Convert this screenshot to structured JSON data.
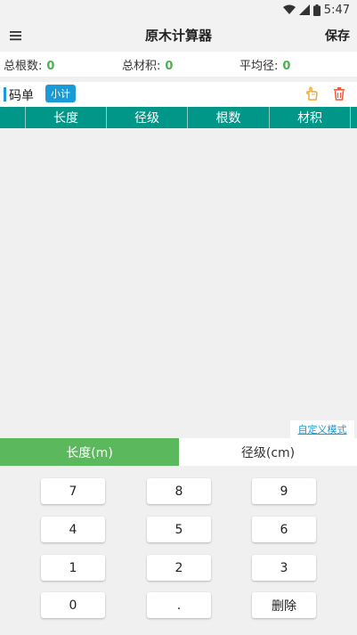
{
  "status_bar": {
    "time": "5:47"
  },
  "app_bar": {
    "title": "原木计算器",
    "save_label": "保存"
  },
  "summary": {
    "total_count_label": "总根数:",
    "total_count_value": "0",
    "total_volume_label": "总材积:",
    "total_volume_value": "0",
    "avg_diameter_label": "平均径:",
    "avg_diameter_value": "0"
  },
  "code_list": {
    "title": "码单",
    "subtotal_label": "小计",
    "columns": [
      "长度",
      "径级",
      "根数",
      "材积"
    ]
  },
  "custom_mode_label": "自定义模式",
  "input_tabs": {
    "length_label": "长度(m)",
    "diameter_label": "径级(cm)",
    "active": "length"
  },
  "keypad": {
    "keys": [
      "7",
      "8",
      "9",
      "4",
      "5",
      "6",
      "1",
      "2",
      "3",
      "0",
      ".",
      "删除"
    ]
  },
  "colors": {
    "table_header": "#009688",
    "active_tab": "#5cb85c",
    "accent": "#1a9bd7",
    "number": "#4caf50",
    "delete_icon": "#f05a3a",
    "hand_icon": "#f0a830"
  }
}
